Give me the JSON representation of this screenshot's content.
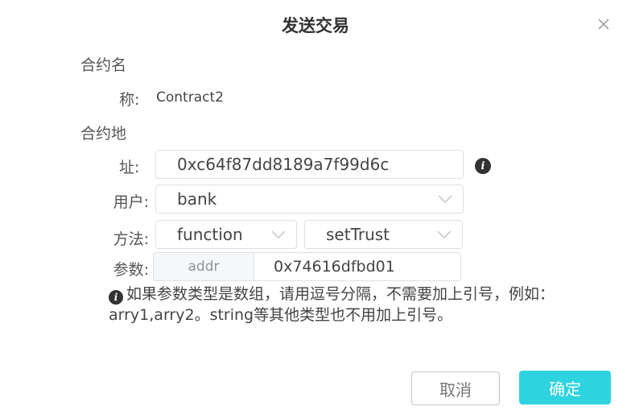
{
  "dialog": {
    "title": "发送交易",
    "close_icon": "close-icon"
  },
  "contract_name": {
    "label_line1": "合约名",
    "label_line2": "称:",
    "value": "Contract2"
  },
  "contract_address": {
    "label_line1": "合约地",
    "label_line2": "址:",
    "value": "0xc64f87dd8189a7f99d6c"
  },
  "user": {
    "label": "用户:",
    "value": "bank"
  },
  "method": {
    "label": "方法:",
    "type_value": "function",
    "name_value": "setTrust"
  },
  "params": {
    "label": "参数:",
    "prepend": "addr",
    "value": "0x74616dfbd01"
  },
  "tip": {
    "icon": "info-icon",
    "text": "如果参数类型是数组，请用逗号分隔，不需要加上引号，例如：arry1,arry2。string等其他类型也不用加上引号。"
  },
  "buttons": {
    "cancel": "取消",
    "confirm": "确定"
  },
  "colors": {
    "primary": "#2ed3e0",
    "border": "#dcdfe6"
  }
}
